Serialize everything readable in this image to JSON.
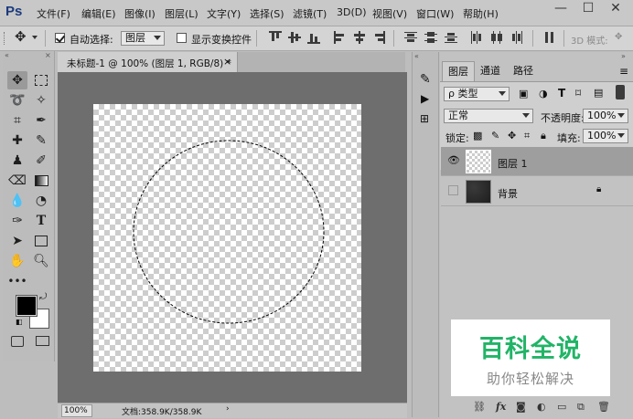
{
  "app": {
    "logo": "Ps"
  },
  "menu": [
    "文件(F)",
    "编辑(E)",
    "图像(I)",
    "图层(L)",
    "文字(Y)",
    "选择(S)",
    "滤镜(T)",
    "3D(D)",
    "视图(V)",
    "窗口(W)",
    "帮助(H)"
  ],
  "window_controls": {
    "minimize": "—",
    "maximize": "☐",
    "close": "✕"
  },
  "options": {
    "auto_select_label": "自动选择:",
    "auto_select_value": "图层",
    "show_transform_label": "显示变换控件",
    "mode_3d_label": "3D 模式:"
  },
  "document": {
    "tab_title": "未标题-1 @ 100% (图层 1, RGB/8) *",
    "tab_close": "×",
    "zoom": "100%",
    "doc_info": "文档:358.9K/358.9K",
    "status_arrow": "›"
  },
  "layers_panel": {
    "tabs": [
      "图层",
      "通道",
      "路径"
    ],
    "filter_label": "ρ 类型",
    "blend_mode": "正常",
    "opacity_label": "不透明度:",
    "opacity_value": "100%",
    "lock_label": "锁定:",
    "fill_label": "填充:",
    "fill_value": "100%",
    "layers": [
      {
        "name": "图层 1",
        "visible": true,
        "selected": true
      },
      {
        "name": "背景",
        "visible": false,
        "locked": true
      }
    ],
    "bottom_icons": [
      "link-icon",
      "fx-icon",
      "mask-icon",
      "adjustment-icon",
      "folder-icon",
      "new-layer-icon",
      "trash-icon"
    ]
  },
  "watermark": {
    "title": "百科全说",
    "subtitle": "助你轻松解决"
  },
  "colors": {
    "menu_logo": "#1c3b7e",
    "pasteboard": "#6e6e6e",
    "watermark_green": "#21b467"
  }
}
